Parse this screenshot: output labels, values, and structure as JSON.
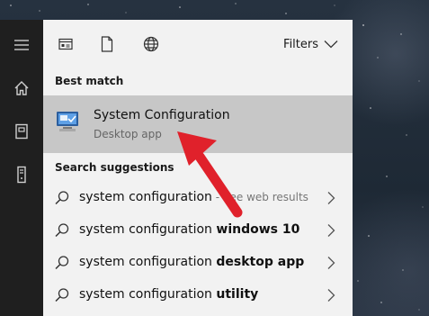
{
  "toolbar": {
    "icons": [
      "apps-icon",
      "document-icon",
      "globe-icon"
    ],
    "filters_label": "Filters"
  },
  "rail": {
    "icons": [
      "hamburger-menu-icon",
      "home-icon",
      "notebook-icon",
      "tower-icon"
    ]
  },
  "best_match": {
    "section_label": "Best match",
    "title": "System Configuration",
    "subtitle": "Desktop app",
    "icon": "system-configuration-icon"
  },
  "suggestions": {
    "section_label": "Search suggestions",
    "items": [
      {
        "query": "system configuration",
        "bold": "",
        "suffix": " - See web results"
      },
      {
        "query": "system configuration ",
        "bold": "windows 10",
        "suffix": ""
      },
      {
        "query": "system configuration ",
        "bold": "desktop app",
        "suffix": ""
      },
      {
        "query": "system configuration ",
        "bold": "utility",
        "suffix": ""
      }
    ]
  },
  "colors": {
    "panel_bg": "#f2f2f2",
    "rail_bg": "#1f1f1f",
    "selected_bg": "#c7c7c7",
    "arrow": "#e0212b"
  }
}
